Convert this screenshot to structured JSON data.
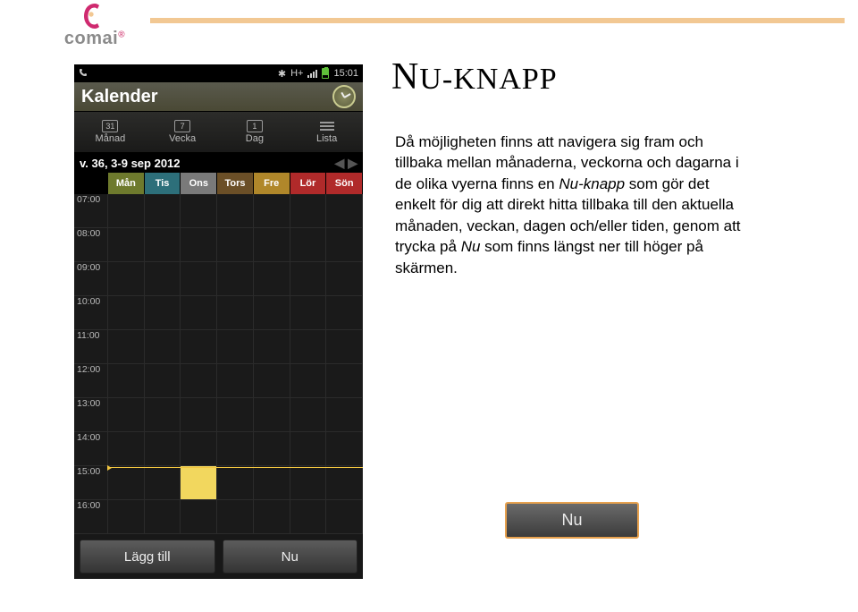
{
  "logo": {
    "text": "comai"
  },
  "page": {
    "title_first": "N",
    "title_rest": "U-KNAPP",
    "body_1": "Då möjligheten finns att navigera sig fram och tillbaka mellan månaderna, veckorna och dagarna i de olika vyerna finns en ",
    "body_it1": "Nu-knapp",
    "body_2": " som gör det enkelt för dig att direkt hitta tillbaka till den aktuella månaden, veckan, dagen och/eller tiden, genom att trycka på ",
    "body_it2": "Nu",
    "body_3": " som finns längst ner till höger på skärmen."
  },
  "nu_button": {
    "label": "Nu"
  },
  "phone": {
    "status": {
      "hplus": "H+",
      "time": "15:01"
    },
    "title": "Kalender",
    "tabs": {
      "month": "Månad",
      "week": "Vecka",
      "day": "Dag",
      "list": "Lista",
      "icon_month": "31",
      "icon_week": "7",
      "icon_day": "1"
    },
    "week_header": "v. 36, 3-9 sep 2012",
    "weekdays": {
      "mon": "Mån",
      "tue": "Tis",
      "wed": "Ons",
      "thu": "Tors",
      "fri": "Fre",
      "sat": "Lör",
      "sun": "Sön"
    },
    "hours": [
      "07:00",
      "08:00",
      "09:00",
      "10:00",
      "11:00",
      "12:00",
      "13:00",
      "14:00",
      "15:00",
      "16:00"
    ],
    "bottom": {
      "add": "Lägg till",
      "now": "Nu"
    }
  }
}
